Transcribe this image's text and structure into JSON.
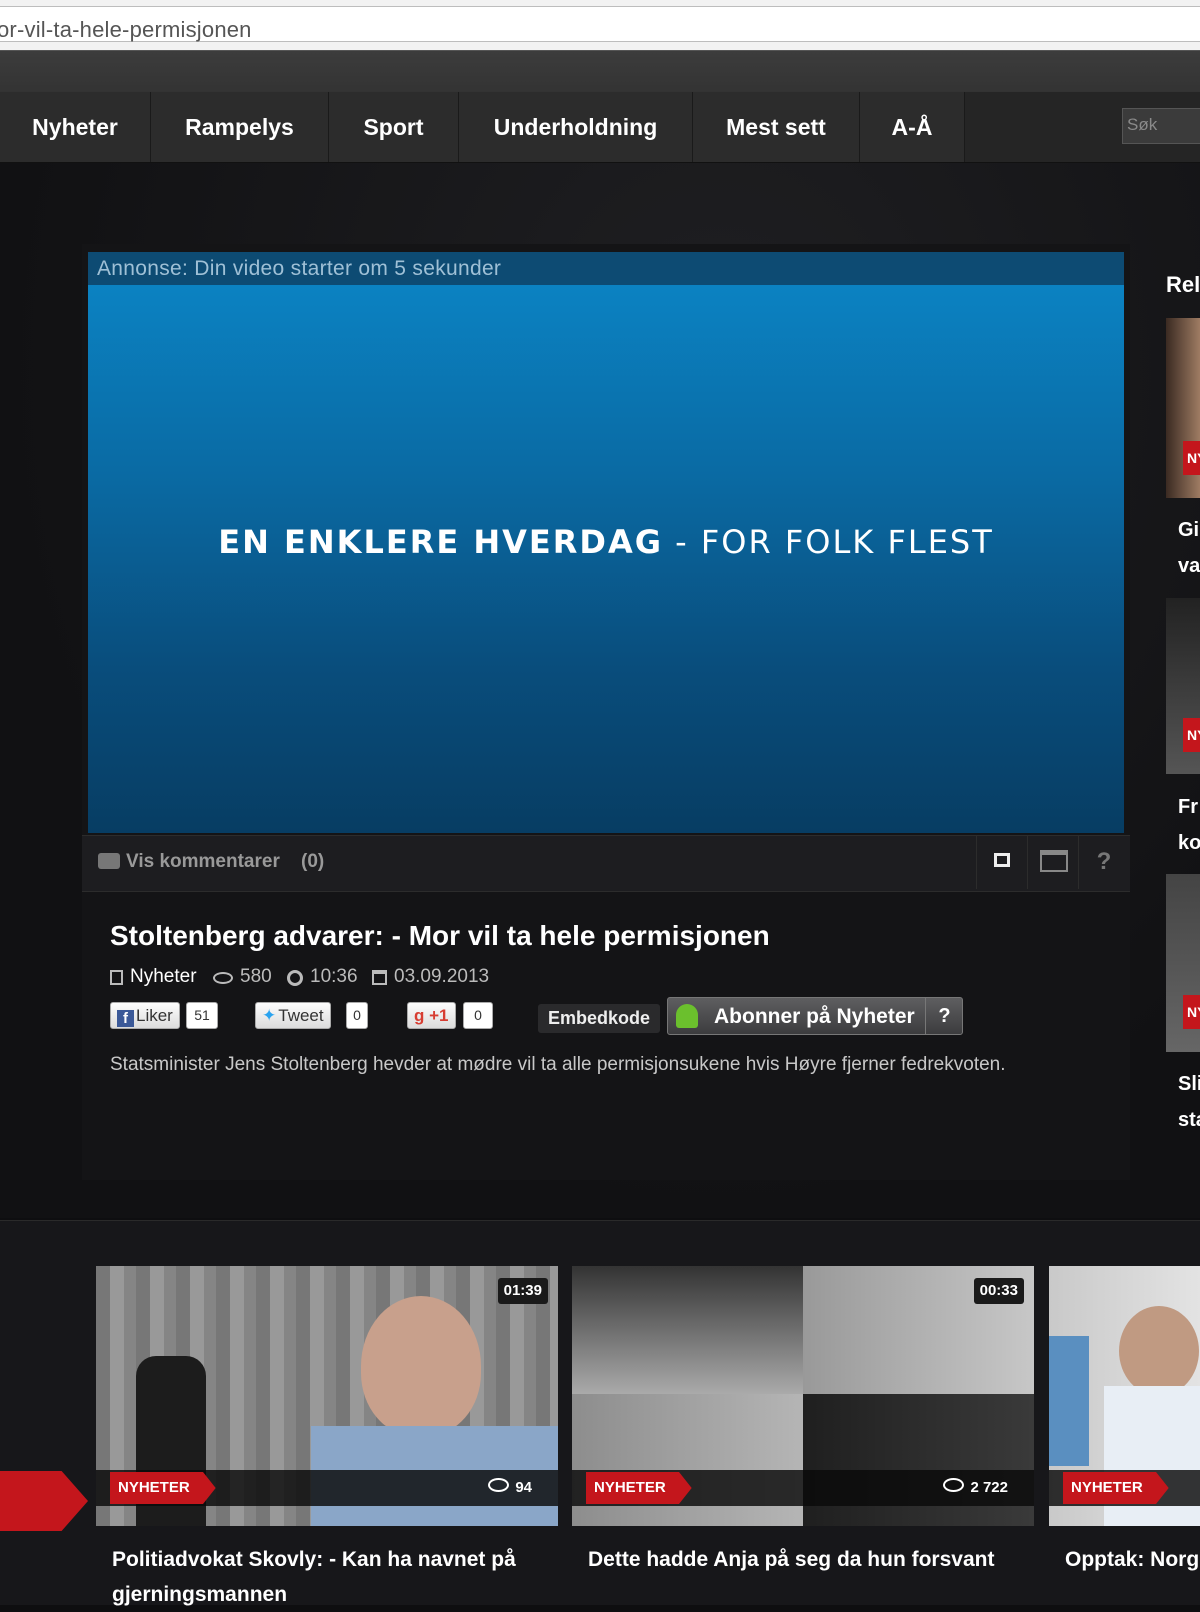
{
  "browser": {
    "url_fragment": "or-vil-ta-hele-permisjonen"
  },
  "nav": {
    "items": [
      "Nyheter",
      "Rampelys",
      "Sport",
      "Underholdning",
      "Mest sett",
      "A-Å"
    ],
    "search_placeholder": "Søk"
  },
  "player": {
    "ad_notice": "Annonse: Din video starter om 5 sekunder",
    "ad_slogan_bold": "EN ENKLERE HVERDAG",
    "ad_slogan_rest": " - FOR FOLK FLEST",
    "comments_label": "Vis kommentarer",
    "comments_count": "(0)",
    "help_label": "?"
  },
  "video": {
    "title": "Stoltenberg advarer: - Mor vil ta hele permisjonen",
    "category": "Nyheter",
    "views": "580",
    "duration_time": "10:36",
    "date": "03.09.2013",
    "description": "Statsminister Jens Stoltenberg hevder at mødre vil ta alle permisjonsukene hvis Høyre fjerner fedrekvoten."
  },
  "social": {
    "facebook_label": "Liker",
    "facebook_count": "51",
    "twitter_label": "Tweet",
    "twitter_count": "0",
    "gplus_label": "+1",
    "gplus_count": "0",
    "embed_label": "Embedkode",
    "subscribe_label": "Abonner på Nyheter",
    "subscribe_help": "?"
  },
  "related": {
    "heading": "Rel",
    "badge": "NY",
    "items": [
      {
        "line1": "Gi",
        "line2": "va"
      },
      {
        "line1": "Fr",
        "line2": "ko"
      },
      {
        "line1": "Sli",
        "line2": "sta"
      }
    ]
  },
  "cards": [
    {
      "duration": "01:39",
      "category": "NYHETER",
      "views": "94",
      "title": "Politiadvokat Skovly: - Kan ha navnet på gjerningsmannen"
    },
    {
      "duration": "00:33",
      "category": "NYHETER",
      "views": "2 722",
      "title": "Dette hadde Anja på seg da hun forsvant"
    },
    {
      "duration": "",
      "category": "NYHETER",
      "views": "",
      "title": "Opptak: Norg september"
    }
  ],
  "colors": {
    "accent_red": "#c4161c",
    "ad_blue": "#0a6aa3"
  }
}
